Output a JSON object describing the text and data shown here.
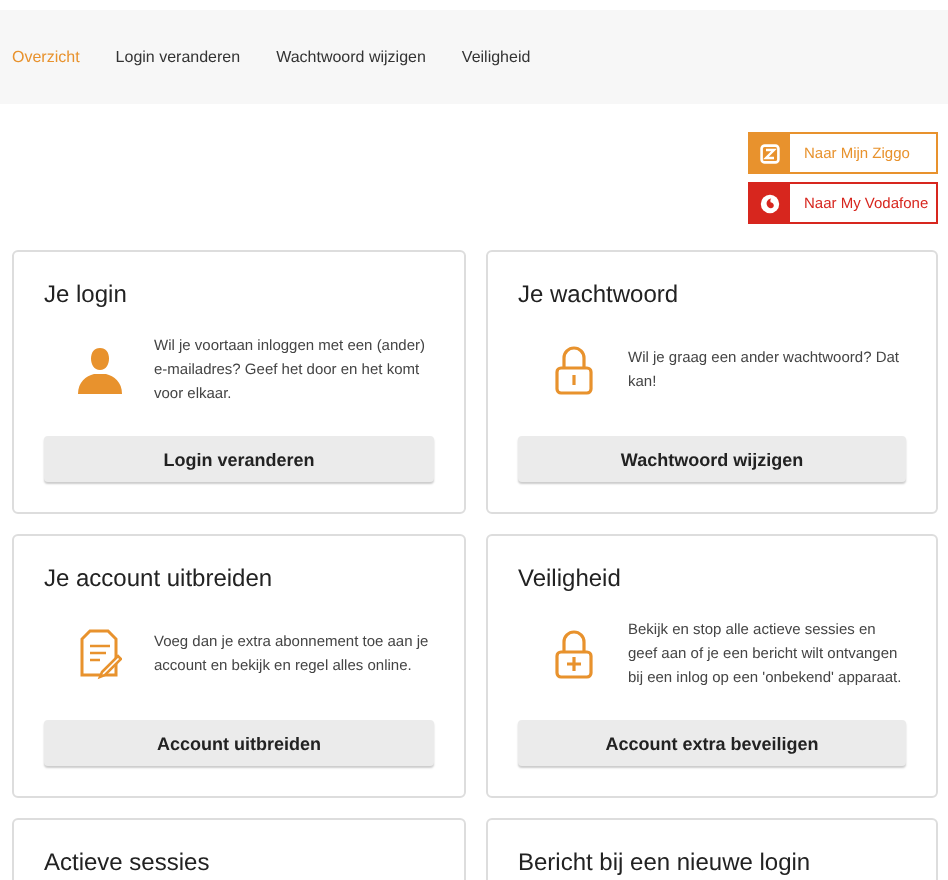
{
  "tabs": [
    {
      "label": "Overzicht",
      "selected": true
    },
    {
      "label": "Login veranderen",
      "selected": false
    },
    {
      "label": "Wachtwoord wijzigen",
      "selected": false
    },
    {
      "label": "Veiligheid",
      "selected": false
    }
  ],
  "portal_links": [
    {
      "kind": "ziggo",
      "label": "Naar Mijn Ziggo",
      "color": "#e8922d"
    },
    {
      "kind": "vodafone",
      "label": "Naar My Vodafone",
      "color": "#d7261e"
    }
  ],
  "cards": [
    {
      "title": "Je login",
      "kind": "login",
      "text": "Wil je voortaan inloggen met een (ander) e-mailadres? Geef het door en het komt voor elkaar.",
      "button": "Login veranderen"
    },
    {
      "title": "Je wachtwoord",
      "kind": "password",
      "text": "Wil je graag een ander wachtwoord? Dat kan!",
      "button": "Wachtwoord wijzigen"
    },
    {
      "title": "Je account uitbreiden",
      "kind": "account",
      "text": "Voeg dan je extra abonnement toe aan je account en bekijk en regel alles online.",
      "button": "Account uitbreiden"
    },
    {
      "title": "Veiligheid",
      "kind": "security",
      "text": "Bekijk en stop alle actieve sessies en geef aan of je een bericht wilt ontvangen bij een inlog op een 'onbekend' apparaat.",
      "button": "Account extra beveiligen"
    },
    {
      "title": "Actieve sessies"
    },
    {
      "title": "Bericht bij een nieuwe login"
    }
  ]
}
